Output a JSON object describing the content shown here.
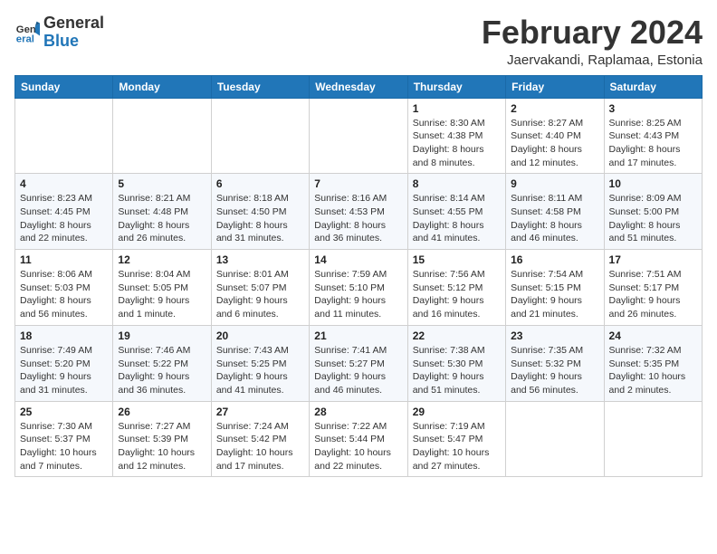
{
  "header": {
    "logo_line1": "General",
    "logo_line2": "Blue",
    "main_title": "February 2024",
    "subtitle": "Jaervakandi, Raplamaa, Estonia"
  },
  "weekdays": [
    "Sunday",
    "Monday",
    "Tuesday",
    "Wednesday",
    "Thursday",
    "Friday",
    "Saturday"
  ],
  "weeks": [
    [
      {
        "day": "",
        "info": ""
      },
      {
        "day": "",
        "info": ""
      },
      {
        "day": "",
        "info": ""
      },
      {
        "day": "",
        "info": ""
      },
      {
        "day": "1",
        "info": "Sunrise: 8:30 AM\nSunset: 4:38 PM\nDaylight: 8 hours\nand 8 minutes."
      },
      {
        "day": "2",
        "info": "Sunrise: 8:27 AM\nSunset: 4:40 PM\nDaylight: 8 hours\nand 12 minutes."
      },
      {
        "day": "3",
        "info": "Sunrise: 8:25 AM\nSunset: 4:43 PM\nDaylight: 8 hours\nand 17 minutes."
      }
    ],
    [
      {
        "day": "4",
        "info": "Sunrise: 8:23 AM\nSunset: 4:45 PM\nDaylight: 8 hours\nand 22 minutes."
      },
      {
        "day": "5",
        "info": "Sunrise: 8:21 AM\nSunset: 4:48 PM\nDaylight: 8 hours\nand 26 minutes."
      },
      {
        "day": "6",
        "info": "Sunrise: 8:18 AM\nSunset: 4:50 PM\nDaylight: 8 hours\nand 31 minutes."
      },
      {
        "day": "7",
        "info": "Sunrise: 8:16 AM\nSunset: 4:53 PM\nDaylight: 8 hours\nand 36 minutes."
      },
      {
        "day": "8",
        "info": "Sunrise: 8:14 AM\nSunset: 4:55 PM\nDaylight: 8 hours\nand 41 minutes."
      },
      {
        "day": "9",
        "info": "Sunrise: 8:11 AM\nSunset: 4:58 PM\nDaylight: 8 hours\nand 46 minutes."
      },
      {
        "day": "10",
        "info": "Sunrise: 8:09 AM\nSunset: 5:00 PM\nDaylight: 8 hours\nand 51 minutes."
      }
    ],
    [
      {
        "day": "11",
        "info": "Sunrise: 8:06 AM\nSunset: 5:03 PM\nDaylight: 8 hours\nand 56 minutes."
      },
      {
        "day": "12",
        "info": "Sunrise: 8:04 AM\nSunset: 5:05 PM\nDaylight: 9 hours\nand 1 minute."
      },
      {
        "day": "13",
        "info": "Sunrise: 8:01 AM\nSunset: 5:07 PM\nDaylight: 9 hours\nand 6 minutes."
      },
      {
        "day": "14",
        "info": "Sunrise: 7:59 AM\nSunset: 5:10 PM\nDaylight: 9 hours\nand 11 minutes."
      },
      {
        "day": "15",
        "info": "Sunrise: 7:56 AM\nSunset: 5:12 PM\nDaylight: 9 hours\nand 16 minutes."
      },
      {
        "day": "16",
        "info": "Sunrise: 7:54 AM\nSunset: 5:15 PM\nDaylight: 9 hours\nand 21 minutes."
      },
      {
        "day": "17",
        "info": "Sunrise: 7:51 AM\nSunset: 5:17 PM\nDaylight: 9 hours\nand 26 minutes."
      }
    ],
    [
      {
        "day": "18",
        "info": "Sunrise: 7:49 AM\nSunset: 5:20 PM\nDaylight: 9 hours\nand 31 minutes."
      },
      {
        "day": "19",
        "info": "Sunrise: 7:46 AM\nSunset: 5:22 PM\nDaylight: 9 hours\nand 36 minutes."
      },
      {
        "day": "20",
        "info": "Sunrise: 7:43 AM\nSunset: 5:25 PM\nDaylight: 9 hours\nand 41 minutes."
      },
      {
        "day": "21",
        "info": "Sunrise: 7:41 AM\nSunset: 5:27 PM\nDaylight: 9 hours\nand 46 minutes."
      },
      {
        "day": "22",
        "info": "Sunrise: 7:38 AM\nSunset: 5:30 PM\nDaylight: 9 hours\nand 51 minutes."
      },
      {
        "day": "23",
        "info": "Sunrise: 7:35 AM\nSunset: 5:32 PM\nDaylight: 9 hours\nand 56 minutes."
      },
      {
        "day": "24",
        "info": "Sunrise: 7:32 AM\nSunset: 5:35 PM\nDaylight: 10 hours\nand 2 minutes."
      }
    ],
    [
      {
        "day": "25",
        "info": "Sunrise: 7:30 AM\nSunset: 5:37 PM\nDaylight: 10 hours\nand 7 minutes."
      },
      {
        "day": "26",
        "info": "Sunrise: 7:27 AM\nSunset: 5:39 PM\nDaylight: 10 hours\nand 12 minutes."
      },
      {
        "day": "27",
        "info": "Sunrise: 7:24 AM\nSunset: 5:42 PM\nDaylight: 10 hours\nand 17 minutes."
      },
      {
        "day": "28",
        "info": "Sunrise: 7:22 AM\nSunset: 5:44 PM\nDaylight: 10 hours\nand 22 minutes."
      },
      {
        "day": "29",
        "info": "Sunrise: 7:19 AM\nSunset: 5:47 PM\nDaylight: 10 hours\nand 27 minutes."
      },
      {
        "day": "",
        "info": ""
      },
      {
        "day": "",
        "info": ""
      }
    ]
  ]
}
